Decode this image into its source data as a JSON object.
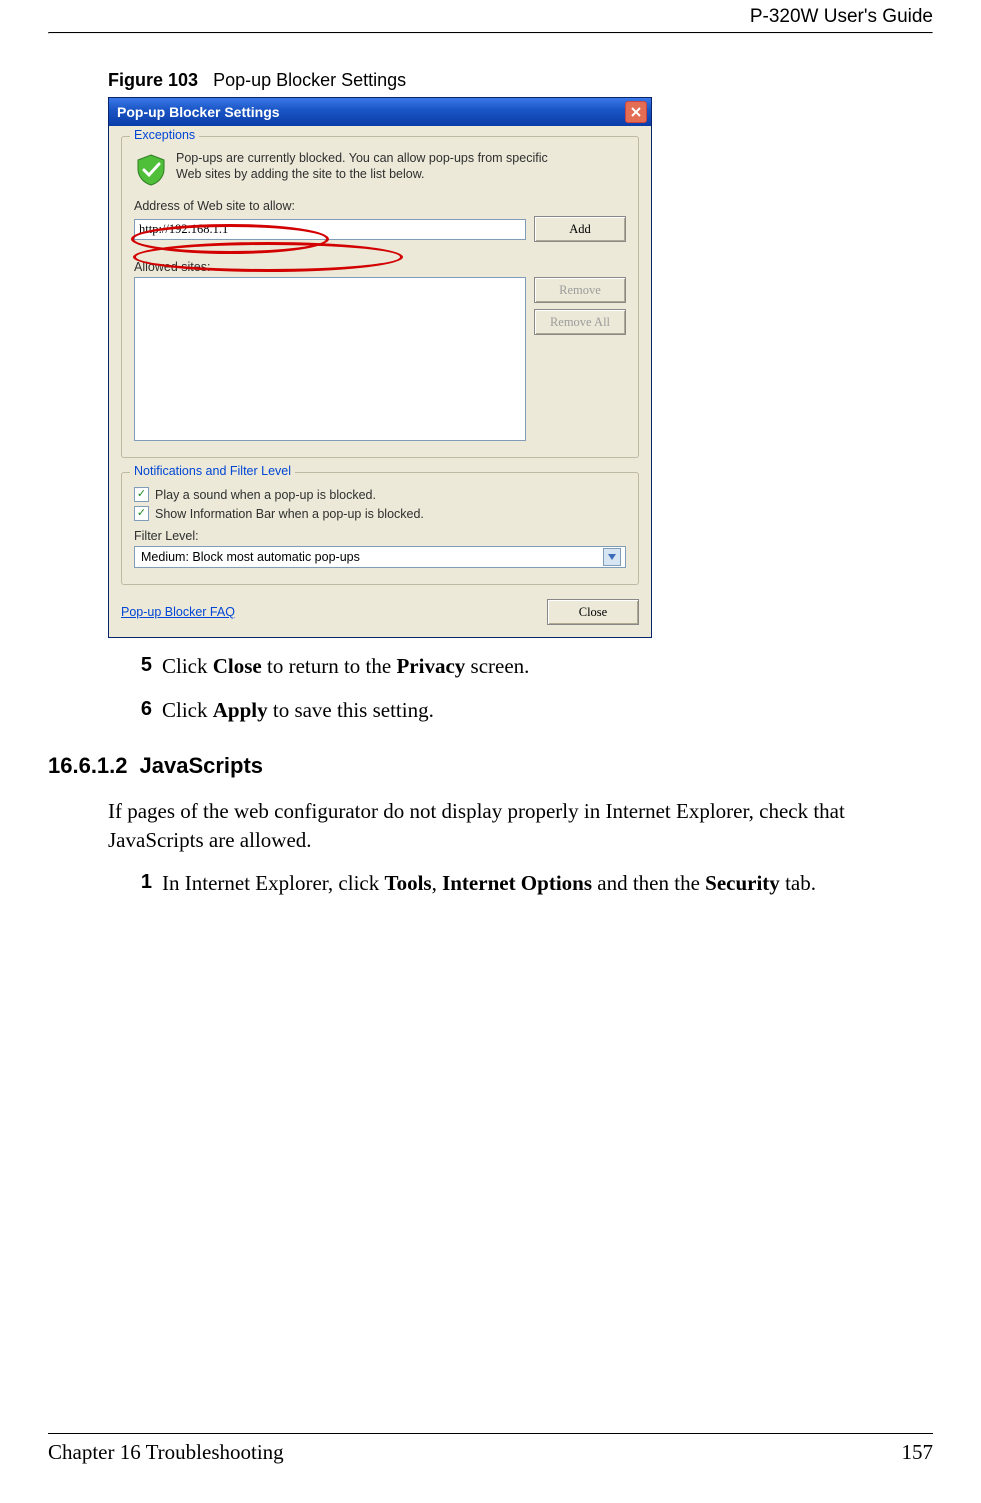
{
  "header": {
    "guide": "P-320W User's Guide"
  },
  "figure": {
    "label": "Figure 103",
    "caption": "Pop-up Blocker Settings"
  },
  "dialog": {
    "title": "Pop-up Blocker Settings",
    "exceptions": {
      "legend": "Exceptions",
      "info_l1": "Pop-ups are currently blocked.  You can allow pop-ups from specific",
      "info_l2": "Web sites by adding the site to the list below.",
      "address_label": "Address of Web site to allow:",
      "address_value": "http://192.168.1.1",
      "add_button": "Add",
      "allowed_label": "Allowed sites:",
      "remove_button": "Remove",
      "remove_all_button": "Remove All"
    },
    "notifications": {
      "legend": "Notifications and Filter Level",
      "check1": "Play a sound when a pop-up is blocked.",
      "check2": "Show Information Bar when a pop-up is blocked.",
      "filter_label": "Filter Level:",
      "filter_value": "Medium: Block most automatic pop-ups"
    },
    "faq": "Pop-up Blocker FAQ",
    "close_button": "Close"
  },
  "steps_after": {
    "s5_num": "5",
    "s5_a": "Click ",
    "s5_b": "Close",
    "s5_c": " to return to the ",
    "s5_d": "Privacy",
    "s5_e": " screen.",
    "s6_num": "6",
    "s6_a": "Click ",
    "s6_b": "Apply",
    "s6_c": " to save this setting."
  },
  "section": {
    "num": "16.6.1.2",
    "title": "JavaScripts",
    "para": "If pages of the web configurator do not display properly in Internet Explorer, check that JavaScripts are allowed.",
    "s1_num": "1",
    "s1_a": "In Internet Explorer, click ",
    "s1_b": "Tools",
    "s1_c": ", ",
    "s1_d": "Internet Options",
    "s1_e": " and then the ",
    "s1_f": "Security",
    "s1_g": " tab."
  },
  "footer": {
    "chapter": "Chapter 16 Troubleshooting",
    "page": "157"
  }
}
